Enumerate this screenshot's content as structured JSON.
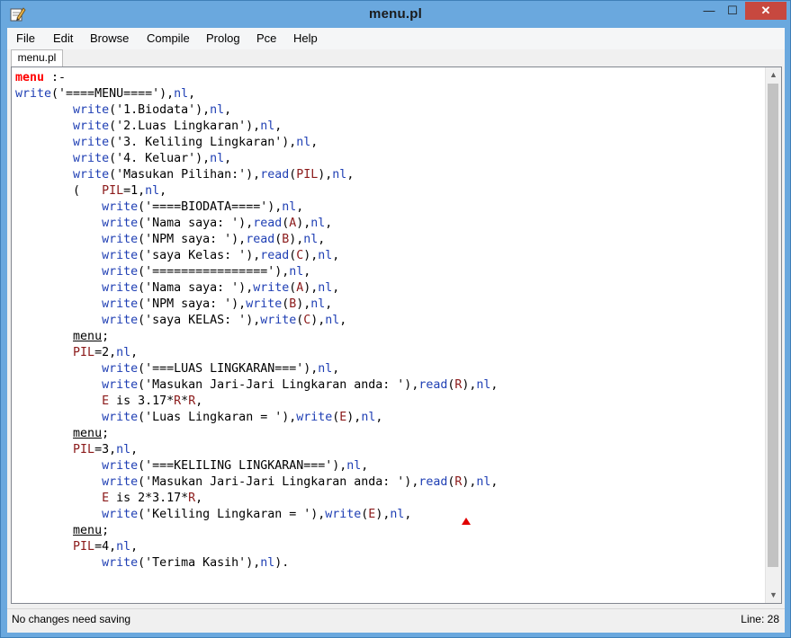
{
  "window": {
    "title": "menu.pl",
    "minimize_glyph": "—",
    "maximize_glyph": "☐",
    "close_glyph": "✕"
  },
  "menubar": [
    "File",
    "Edit",
    "Browse",
    "Compile",
    "Prolog",
    "Pce",
    "Help"
  ],
  "tab": {
    "label": "menu.pl"
  },
  "code_lines": [
    [
      [
        "head",
        "menu"
      ],
      [
        "pun",
        " :-"
      ]
    ],
    [
      [
        "builtin",
        "write"
      ],
      [
        "pun",
        "('====MENU===='),"
      ],
      [
        "builtin",
        "nl"
      ],
      [
        "pun",
        ","
      ]
    ],
    [
      [
        "pun",
        "        "
      ],
      [
        "builtin",
        "write"
      ],
      [
        "pun",
        "('1.Biodata'),"
      ],
      [
        "builtin",
        "nl"
      ],
      [
        "pun",
        ","
      ]
    ],
    [
      [
        "pun",
        "        "
      ],
      [
        "builtin",
        "write"
      ],
      [
        "pun",
        "('2.Luas Lingkaran'),"
      ],
      [
        "builtin",
        "nl"
      ],
      [
        "pun",
        ","
      ]
    ],
    [
      [
        "pun",
        "        "
      ],
      [
        "builtin",
        "write"
      ],
      [
        "pun",
        "('3. Keliling Lingkaran'),"
      ],
      [
        "builtin",
        "nl"
      ],
      [
        "pun",
        ","
      ]
    ],
    [
      [
        "pun",
        "        "
      ],
      [
        "builtin",
        "write"
      ],
      [
        "pun",
        "('4. Keluar'),"
      ],
      [
        "builtin",
        "nl"
      ],
      [
        "pun",
        ","
      ]
    ],
    [
      [
        "pun",
        "        "
      ],
      [
        "builtin",
        "write"
      ],
      [
        "pun",
        "('Masukan Pilihan:'),"
      ],
      [
        "builtin",
        "read"
      ],
      [
        "pun",
        "("
      ],
      [
        "var",
        "PIL"
      ],
      [
        "pun",
        "),"
      ],
      [
        "builtin",
        "nl"
      ],
      [
        "pun",
        ","
      ]
    ],
    [
      [
        "pun",
        "        (   "
      ],
      [
        "var",
        "PIL"
      ],
      [
        "pun",
        "=1,"
      ],
      [
        "builtin",
        "nl"
      ],
      [
        "pun",
        ","
      ]
    ],
    [
      [
        "pun",
        "            "
      ],
      [
        "builtin",
        "write"
      ],
      [
        "pun",
        "('====BIODATA===='),"
      ],
      [
        "builtin",
        "nl"
      ],
      [
        "pun",
        ","
      ]
    ],
    [
      [
        "pun",
        "            "
      ],
      [
        "builtin",
        "write"
      ],
      [
        "pun",
        "('Nama saya: '),"
      ],
      [
        "builtin",
        "read"
      ],
      [
        "pun",
        "("
      ],
      [
        "var",
        "A"
      ],
      [
        "pun",
        "),"
      ],
      [
        "builtin",
        "nl"
      ],
      [
        "pun",
        ","
      ]
    ],
    [
      [
        "pun",
        "            "
      ],
      [
        "builtin",
        "write"
      ],
      [
        "pun",
        "('NPM saya: '),"
      ],
      [
        "builtin",
        "read"
      ],
      [
        "pun",
        "("
      ],
      [
        "var",
        "B"
      ],
      [
        "pun",
        "),"
      ],
      [
        "builtin",
        "nl"
      ],
      [
        "pun",
        ","
      ]
    ],
    [
      [
        "pun",
        "            "
      ],
      [
        "builtin",
        "write"
      ],
      [
        "pun",
        "('saya Kelas: '),"
      ],
      [
        "builtin",
        "read"
      ],
      [
        "pun",
        "("
      ],
      [
        "var",
        "C"
      ],
      [
        "pun",
        "),"
      ],
      [
        "builtin",
        "nl"
      ],
      [
        "pun",
        ","
      ]
    ],
    [
      [
        "pun",
        "            "
      ],
      [
        "builtin",
        "write"
      ],
      [
        "pun",
        "('================'),"
      ],
      [
        "builtin",
        "nl"
      ],
      [
        "pun",
        ","
      ]
    ],
    [
      [
        "pun",
        "            "
      ],
      [
        "builtin",
        "write"
      ],
      [
        "pun",
        "('Nama saya: '),"
      ],
      [
        "builtin",
        "write"
      ],
      [
        "pun",
        "("
      ],
      [
        "var",
        "A"
      ],
      [
        "pun",
        "),"
      ],
      [
        "builtin",
        "nl"
      ],
      [
        "pun",
        ","
      ]
    ],
    [
      [
        "pun",
        "            "
      ],
      [
        "builtin",
        "write"
      ],
      [
        "pun",
        "('NPM saya: '),"
      ],
      [
        "builtin",
        "write"
      ],
      [
        "pun",
        "("
      ],
      [
        "var",
        "B"
      ],
      [
        "pun",
        "),"
      ],
      [
        "builtin",
        "nl"
      ],
      [
        "pun",
        ","
      ]
    ],
    [
      [
        "pun",
        "            "
      ],
      [
        "builtin",
        "write"
      ],
      [
        "pun",
        "('saya KELAS: '),"
      ],
      [
        "builtin",
        "write"
      ],
      [
        "pun",
        "("
      ],
      [
        "var",
        "C"
      ],
      [
        "pun",
        "),"
      ],
      [
        "builtin",
        "nl"
      ],
      [
        "pun",
        ","
      ]
    ],
    [
      [
        "pun",
        "        "
      ],
      [
        "under",
        "menu"
      ],
      [
        "pun",
        ";"
      ]
    ],
    [
      [
        "pun",
        "        "
      ],
      [
        "var",
        "PIL"
      ],
      [
        "pun",
        "=2,"
      ],
      [
        "builtin",
        "nl"
      ],
      [
        "pun",
        ","
      ]
    ],
    [
      [
        "pun",
        "            "
      ],
      [
        "builtin",
        "write"
      ],
      [
        "pun",
        "('===LUAS LINGKARAN==='),"
      ],
      [
        "builtin",
        "nl"
      ],
      [
        "pun",
        ","
      ]
    ],
    [
      [
        "pun",
        "            "
      ],
      [
        "builtin",
        "write"
      ],
      [
        "pun",
        "('Masukan Jari-Jari Lingkaran anda: '),"
      ],
      [
        "builtin",
        "read"
      ],
      [
        "pun",
        "("
      ],
      [
        "var",
        "R"
      ],
      [
        "pun",
        "),"
      ],
      [
        "builtin",
        "nl"
      ],
      [
        "pun",
        ","
      ]
    ],
    [
      [
        "pun",
        "            "
      ],
      [
        "var",
        "E"
      ],
      [
        "pun",
        " is 3.17*"
      ],
      [
        "var",
        "R"
      ],
      [
        "pun",
        "*"
      ],
      [
        "var",
        "R"
      ],
      [
        "pun",
        ","
      ]
    ],
    [
      [
        "pun",
        "            "
      ],
      [
        "builtin",
        "write"
      ],
      [
        "pun",
        "('Luas Lingkaran = '),"
      ],
      [
        "builtin",
        "write"
      ],
      [
        "pun",
        "("
      ],
      [
        "var",
        "E"
      ],
      [
        "pun",
        "),"
      ],
      [
        "builtin",
        "nl"
      ],
      [
        "pun",
        ","
      ]
    ],
    [
      [
        "pun",
        "        "
      ],
      [
        "under",
        "menu"
      ],
      [
        "pun",
        ";"
      ]
    ],
    [
      [
        "pun",
        "        "
      ],
      [
        "var",
        "PIL"
      ],
      [
        "pun",
        "=3,"
      ],
      [
        "builtin",
        "nl"
      ],
      [
        "pun",
        ","
      ]
    ],
    [
      [
        "pun",
        "            "
      ],
      [
        "builtin",
        "write"
      ],
      [
        "pun",
        "('===KELILING LINGKARAN==='),"
      ],
      [
        "builtin",
        "nl"
      ],
      [
        "pun",
        ","
      ]
    ],
    [
      [
        "pun",
        "            "
      ],
      [
        "builtin",
        "write"
      ],
      [
        "pun",
        "('Masukan Jari-Jari Lingkaran anda: '),"
      ],
      [
        "builtin",
        "read"
      ],
      [
        "pun",
        "("
      ],
      [
        "var",
        "R"
      ],
      [
        "pun",
        "),"
      ],
      [
        "builtin",
        "nl"
      ],
      [
        "pun",
        ","
      ]
    ],
    [
      [
        "pun",
        "            "
      ],
      [
        "var",
        "E"
      ],
      [
        "pun",
        " is 2*3.17*"
      ],
      [
        "var",
        "R"
      ],
      [
        "pun",
        ","
      ]
    ],
    [
      [
        "pun",
        "            "
      ],
      [
        "builtin",
        "write"
      ],
      [
        "pun",
        "('Keliling Lingkaran = '),"
      ],
      [
        "builtin",
        "write"
      ],
      [
        "pun",
        "("
      ],
      [
        "var",
        "E"
      ],
      [
        "pun",
        "),"
      ],
      [
        "builtin",
        "nl"
      ],
      [
        "pun",
        ","
      ]
    ],
    [
      [
        "pun",
        "        "
      ],
      [
        "under",
        "menu"
      ],
      [
        "pun",
        ";"
      ]
    ],
    [
      [
        "pun",
        "        "
      ],
      [
        "var",
        "PIL"
      ],
      [
        "pun",
        "=4,"
      ],
      [
        "builtin",
        "nl"
      ],
      [
        "pun",
        ","
      ]
    ],
    [
      [
        "pun",
        "            "
      ],
      [
        "builtin",
        "write"
      ],
      [
        "pun",
        "('Terima Kasih'),"
      ],
      [
        "builtin",
        "nl"
      ],
      [
        "pun",
        ")."
      ]
    ]
  ],
  "status": {
    "left": "No changes need saving",
    "right": "Line: 28"
  },
  "colors": {
    "head": "#ff0000",
    "builtin": "#1f3fb4",
    "variable": "#8b1a1a",
    "title_bar": "#6aa8de",
    "close_button": "#c7483f"
  },
  "icons": {
    "app": "pencil-edit-icon",
    "scroll_up": "scroll-up-arrow-icon",
    "scroll_down": "scroll-down-arrow-icon",
    "marker": "error-marker-icon"
  }
}
